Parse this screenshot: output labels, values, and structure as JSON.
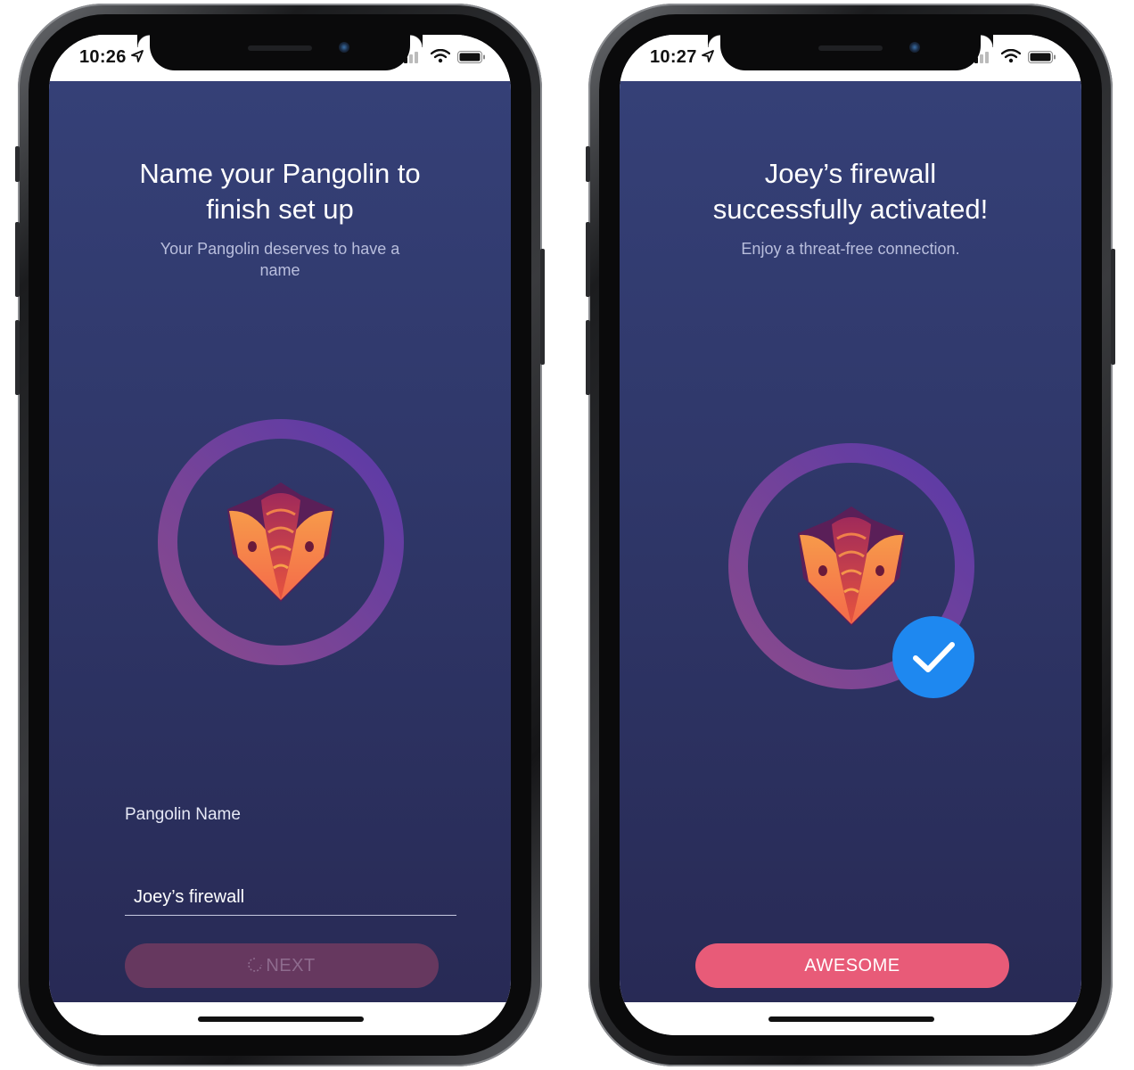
{
  "left_phone": {
    "status": {
      "time": "10:26"
    },
    "title": "Name your Pangolin to finish set up",
    "subtitle": "Your Pangolin deserves to have a name",
    "field": {
      "label": "Pangolin Name",
      "value": "Joey’s firewall"
    },
    "button": {
      "label": "NEXT",
      "state": "loading"
    }
  },
  "right_phone": {
    "status": {
      "time": "10:27"
    },
    "title": "Joey’s firewall successfully activated!",
    "subtitle": "Enjoy a threat-free connection.",
    "button": {
      "label": "AWESOME"
    }
  },
  "colors": {
    "background_top": "#354077",
    "background_bottom": "#282a55",
    "ring_start": "#8a4a8c",
    "ring_end": "#5a3aa8",
    "button_primary": "#e85b78",
    "button_disabled": "#66385f",
    "check_badge": "#1e88f0"
  },
  "icons": [
    "location-arrow-icon",
    "cellular-signal-icon",
    "wifi-icon",
    "battery-icon",
    "pangolin-logo-icon",
    "checkmark-icon",
    "spinner-icon"
  ]
}
